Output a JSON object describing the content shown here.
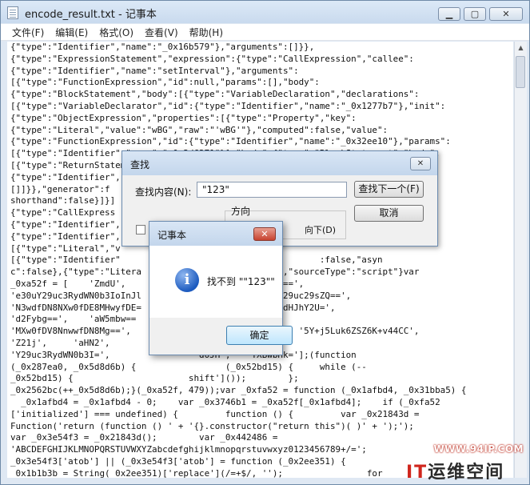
{
  "window": {
    "title": "encode_result.txt - 记事本",
    "controls": {
      "minimize": "▁",
      "maximize": "▢",
      "close": "✕"
    }
  },
  "menu": [
    "文件(F)",
    "编辑(E)",
    "格式(O)",
    "查看(V)",
    "帮助(H)"
  ],
  "editor": {
    "lines": [
      "{\"type\":\"Identifier\",\"name\":\"_0x16b579\"},\"arguments\":[]}},",
      "{\"type\":\"ExpressionStatement\",\"expression\":{\"type\":\"CallExpression\",\"callee\":",
      "{\"type\":\"Identifier\",\"name\":\"setInterval\"},\"arguments\":",
      "[{\"type\":\"FunctionExpression\",\"id\":null,\"params\":[],\"body\":",
      "{\"type\":\"BlockStatement\",\"body\":[{\"type\":\"VariableDeclaration\",\"declarations\":",
      "[{\"type\":\"VariableDeclarator\",\"id\":{\"type\":\"Identifier\",\"name\":\"_0x1277b7\"},\"init\":",
      "{\"type\":\"ObjectExpression\",\"properties\":[{\"type\":\"Property\",\"key\":",
      "{\"type\":\"Literal\",\"value\":\"wBG\",\"raw\":\"'wBG'\"},\"computed\":false,\"value\":",
      "{\"type\":\"FunctionExpression\",\"id\":{\"type\":\"Identifier\",\"name\":\"_0x32ee10\"},\"params\":",
      "[{\"type\":\"Identifier\",\"name\":\"_0x2d6371\"}],\"body\":{\"type\":\"BlockStatement\",\"body\":",
      "[{\"type\":\"ReturnStatement\",",
      "{\"type\":\"Identifier\",",
      "[]]}},\"generator\":f                                             hod\":false,\"",
      "shorthand\":false}]}]                                          \":",
      "{\"type\":\"CallExpress                                          \"object\":",
      "{\"type\":\"Identifier\",                                          callee\":",
      "{\"type\":\"Identifier\",",
      "[{\"type\":\"Literal\",\"v",
      "[{\"type\":\"Identifier\"                                      :false,\"asyn",
      "c\":false},{\"type\":\"Litera                  }]}}]}]}},\"sourceType\":\"script\"}var",
      "_0xa52f = [    'ZmdU',                  bjdGlvbigpIA==',",
      "'e30uY29uc3RydWN0b3IoInJl               KRO',     'Y29uc29sZQ==',",
      "'N3wdfDN8NXw0fDE8MHwyfDE=               0aW9u',    'dHJhY2U=',",
      "'d2Fybg==',    'aW5mbw==                   'bG9n',",
      "'MXw0fDV8NnwwfDN8Mg==',                     'MTIz',    '5Y+j5Luk6ZSZ6K+v44CC',",
      "'Z21j',     'aHN2',                 FY',    'ZV1Y',",
      "'Y29uc3RydWN0b3I=',                 d0JH',   'YXBwbHk='];(function",
      "(_0x287ea0, _0x5d8d6b) {                 (_0x52bd15) {     while (--",
      "_0x52bd15) {                      shift']());        };",
      "_0x2562bc(++_0x5d8d6b);}(_0xa52f, 479));var _0xfa52 = function (_0x1afbd4, _0x31bba5) {",
      "  _0x1afbd4 = _0x1afbd4 - 0;    var _0x3746b1 = _0xa52f[_0x1afbd4];    if (_0xfa52",
      "['initialized'] === undefined) {         function () {         var _0x21843d =",
      "Function('return (function () ' + '{}.constructor(\"return this\")( )' + ');');",
      "var _0x3e54f3 = _0x21843d();        var _0x442486 =",
      "'ABCDEFGHIJKLMNOPQRSTUVWXYZabcdefghijklmnopqrstuvwxyz0123456789+/=';",
      "_0x3e54f3['atob'] || (_0x3e54f3['atob'] = function (_0x2ee351) {",
      "_0x1b1b3b = String(_0x2ee351)['replace'](/=+$/, '');                for",
      "0, _0x30beee, _0x29f861, _0x4017f4 = 0, _0x2de70f = '', _0x29f861 ="
    ]
  },
  "find_dialog": {
    "title": "查找",
    "find_label": "查找内容(N):",
    "find_value": "\"123\"",
    "direction_label": "方向",
    "down_label": "向下(D)",
    "find_next_label": "查找下一个(F)",
    "cancel_label": "取消",
    "close_glyph": "✕"
  },
  "alert_dialog": {
    "title": "记事本",
    "message": "找不到 \"\"123\"\"",
    "ok_label": "确定",
    "icon_glyph": "i",
    "close_glyph": "✕"
  },
  "watermark": {
    "url": "WWW.94IP.COM",
    "brand_it": "IT",
    "brand_rest": "运维空间"
  },
  "colors": {
    "titlebar": "#c9daee",
    "close_red": "#c7422f",
    "info_icon_blue": "#1d5bbf",
    "watermark_red": "#d0261d"
  }
}
